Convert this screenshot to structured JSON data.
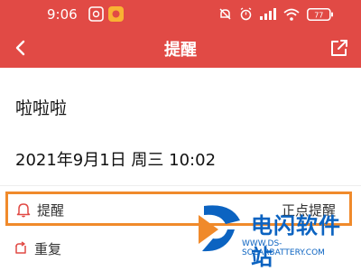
{
  "status_bar": {
    "time": "9:06",
    "battery": "77"
  },
  "title_bar": {
    "title": "提醒"
  },
  "note": {
    "title": "啦啦啦",
    "datetime": "2021年9月1日 周三 10:02"
  },
  "reminder": {
    "label": "提醒",
    "value": "正点提醒"
  },
  "repeat": {
    "label": "重复"
  },
  "watermark": {
    "name": "电闪软件站",
    "url": "WWW.DS-SOLARBATTERY.COM"
  },
  "colors": {
    "header": "#e14a45",
    "highlight": "#f08a2b",
    "watermark": "#0b63c1"
  }
}
